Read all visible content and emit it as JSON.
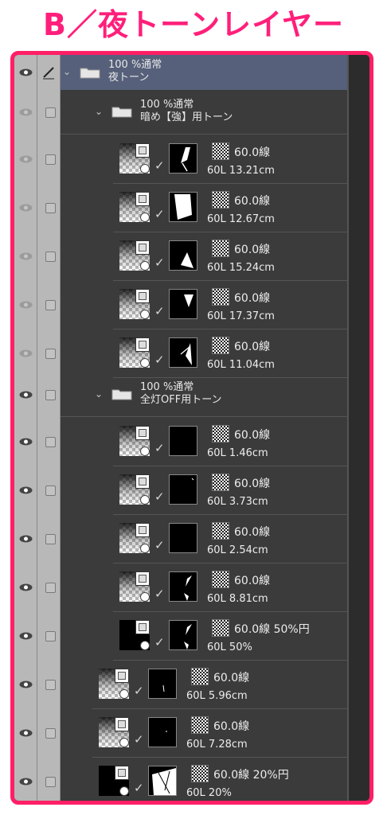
{
  "title": "B／夜トーンレイヤー",
  "folders": [
    {
      "line1": "100 %通常",
      "line2": "夜トーン"
    },
    {
      "line1": "100 %通常",
      "line2": "暗め【強】用トーン"
    },
    {
      "line1": "100 %通常",
      "line2": "全灯OFF用トーン"
    }
  ],
  "layers_group1": [
    {
      "line1": "60.0線",
      "line2": "60L 13.21cm"
    },
    {
      "line1": "60.0線",
      "line2": "60L 12.67cm"
    },
    {
      "line1": "60.0線",
      "line2": "60L 15.24cm"
    },
    {
      "line1": "60.0線",
      "line2": "60L 17.37cm"
    },
    {
      "line1": "60.0線",
      "line2": "60L 11.04cm"
    }
  ],
  "layers_group2": [
    {
      "line1": "60.0線",
      "line2": "60L 1.46cm"
    },
    {
      "line1": "60.0線",
      "line2": "60L 3.73cm"
    },
    {
      "line1": "60.0線",
      "line2": "60L 2.54cm"
    },
    {
      "line1": "60.0線",
      "line2": "60L 8.81cm"
    },
    {
      "line1": "60.0線 50%円",
      "line2": "60L 50%"
    }
  ],
  "layers_root": [
    {
      "line1": "60.0線",
      "line2": "60L 5.96cm"
    },
    {
      "line1": "60.0線",
      "line2": "60L 7.28cm"
    },
    {
      "line1": "60.0線 20%円",
      "line2": "60L 20%"
    }
  ],
  "colors": {
    "accent": "#ff1f66",
    "panel": "#3b3b3b",
    "selected": "#56607a"
  },
  "icons": [
    "eye-icon",
    "pen-icon",
    "folder-icon",
    "chevron-down-icon",
    "checkbox-icon",
    "check-icon"
  ]
}
